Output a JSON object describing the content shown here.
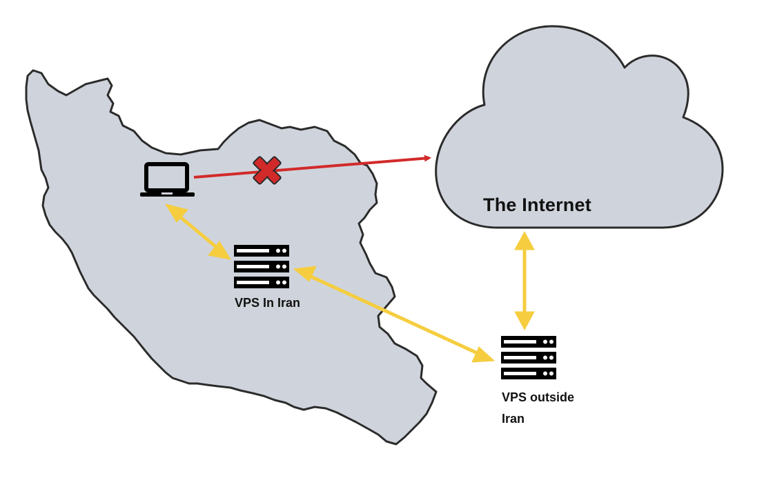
{
  "labels": {
    "internet": "The Internet",
    "vps_in": "VPS In Iran",
    "vps_out_line1": "VPS outside",
    "vps_out_line2": "Iran"
  },
  "colors": {
    "map_fill": "#cfd4dc",
    "map_stroke": "#2b2b2b",
    "cloud_fill": "#cfd4dc",
    "blocked_arrow": "#d22a2a",
    "tunnel_arrow": "#f5cd3f",
    "icon": "#000000"
  },
  "icons": [
    "laptop-icon",
    "server-icon",
    "server-icon",
    "blocked-x-icon",
    "cloud-icon"
  ]
}
